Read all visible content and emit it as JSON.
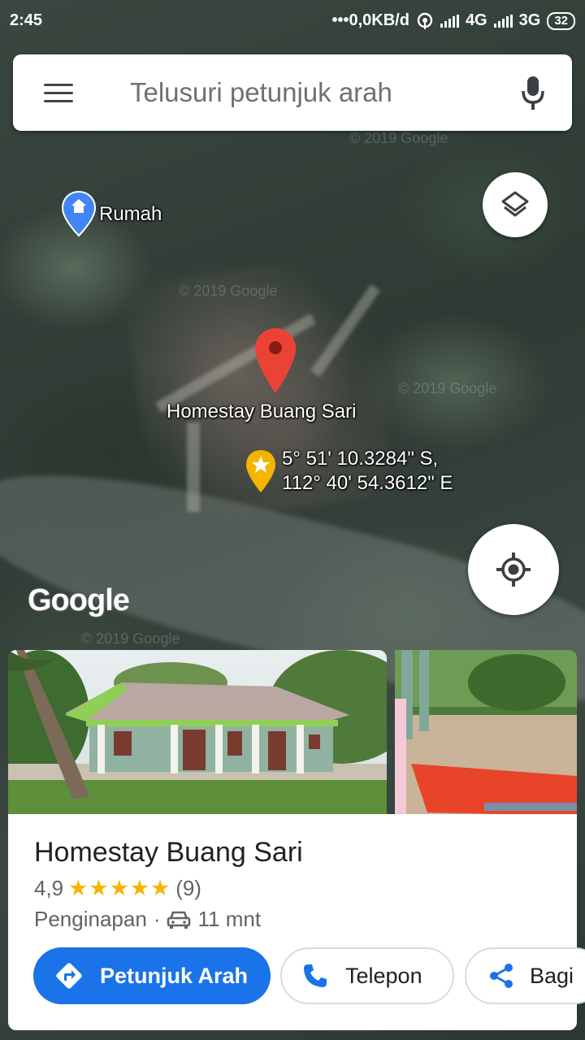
{
  "status_bar": {
    "time": "2:45",
    "speed": "•••0,0KB/d",
    "network1": "4G",
    "network2": "3G",
    "battery": "32"
  },
  "search": {
    "placeholder": "Telusuri petunjuk arah",
    "menu_icon": "hamburger-menu-icon",
    "mic_icon": "microphone-icon"
  },
  "map": {
    "home_label": "Rumah",
    "place_label": "Homestay Buang Sari",
    "coordinate_line1": "5° 51' 10.3284\" S,",
    "coordinate_line2": "112° 40' 54.3612\" E",
    "watermark": "© 2019 Google",
    "logo": "Google",
    "layers_icon": "layers-icon",
    "location_icon": "my-location-icon"
  },
  "place_card": {
    "name": "Homestay Buang Sari",
    "rating": "4,9",
    "stars": "★★★★★",
    "review_count": "(9)",
    "category": "Penginapan",
    "separator": "·",
    "drive_time": "11 mnt",
    "buttons": {
      "directions": "Petunjuk Arah",
      "call": "Telepon",
      "share": "Bagi"
    }
  },
  "colors": {
    "primary": "#1a73e8",
    "star": "#f6b400",
    "pin_red": "#ea4335",
    "pin_blue": "#4285f4",
    "pin_yellow": "#f4b400"
  }
}
